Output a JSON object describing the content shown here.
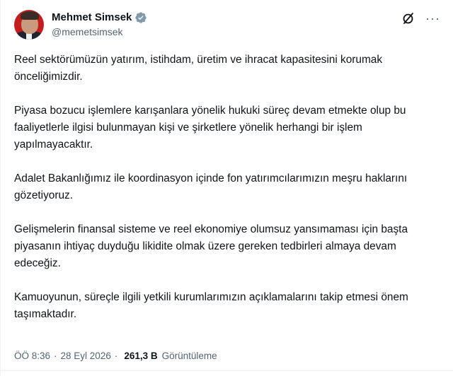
{
  "author": {
    "display_name": "Mehmet Simsek",
    "handle": "@memetsimsek",
    "verified": true,
    "verified_color": "#829aab"
  },
  "post": {
    "paragraphs": [
      "Reel sektörümüzün yatırım, istihdam, üretim ve ihracat kapasitesini korumak önceliğimizdir.",
      "Piyasa bozucu işlemlere karışanlara yönelik hukuki süreç devam etmekte olup bu faaliyetlerle ilgisi bulunmayan kişi ve şirketlere yönelik herhangi bir işlem yapılmayacaktır.",
      "Adalet Bakanlığımız ile koordinasyon içinde fon yatırımcılarımızın meşru haklarını gözetiyoruz.",
      "Gelişmelerin finansal sisteme ve reel ekonomiye olumsuz yansımaması için başta piyasanın ihtiyaç duyduğu likidite olmak üzere gereken tedbirleri almaya devam edeceğiz.",
      "Kamuoyunun, süreçle ilgili yetkili kurumlarımızın açıklamalarını takip etmesi önem taşımaktadır."
    ],
    "time": "ÖÖ 8:36",
    "date": "28 Eyl 2026",
    "views_count": "261,3 B",
    "views_label": "Görüntüleme",
    "separator": "·"
  },
  "actions": {
    "grok_icon": "grok-slash-icon",
    "more_icon": "more-horizontal-icon",
    "more_glyph": "···"
  }
}
